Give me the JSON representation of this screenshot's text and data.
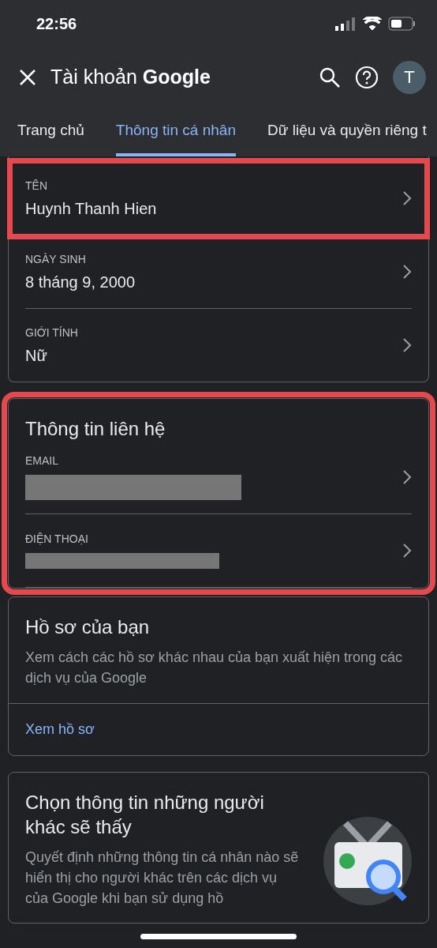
{
  "status_bar": {
    "time": "22:56"
  },
  "header": {
    "title": "Tài khoản",
    "brand": "Google",
    "avatar": "T"
  },
  "tabs": [
    {
      "label": "Trang chủ",
      "selected": false
    },
    {
      "label": "Thông tin cá nhân",
      "selected": true
    },
    {
      "label": "Dữ liệu và quyền riêng t",
      "selected": false
    }
  ],
  "basic_info": {
    "rows": [
      {
        "label": "TÊN",
        "value": "Huynh Thanh Hien",
        "highlighted": true
      },
      {
        "label": "NGÀY SINH",
        "value": "8 tháng 9, 2000",
        "highlighted": false
      },
      {
        "label": "GIỚI TÍNH",
        "value": "Nữ",
        "highlighted": false
      }
    ]
  },
  "contact": {
    "title": "Thông tin liên hệ",
    "highlighted": true,
    "rows": [
      {
        "label": "EMAIL",
        "redacted": true
      },
      {
        "label": "ĐIỆN THOẠI",
        "redacted": true
      }
    ]
  },
  "profile": {
    "title": "Hồ sơ của bạn",
    "description": "Xem cách các hồ sơ khác nhau của bạn xuất hiện trong các dịch vụ của Google",
    "link": "Xem hồ sơ"
  },
  "visibility": {
    "title": "Chọn thông tin những người khác sẽ thấy",
    "description": "Quyết định những thông tin cá nhân nào sẽ hiển thị cho người khác trên các dịch vụ của Google khi bạn sử dụng hồ"
  }
}
